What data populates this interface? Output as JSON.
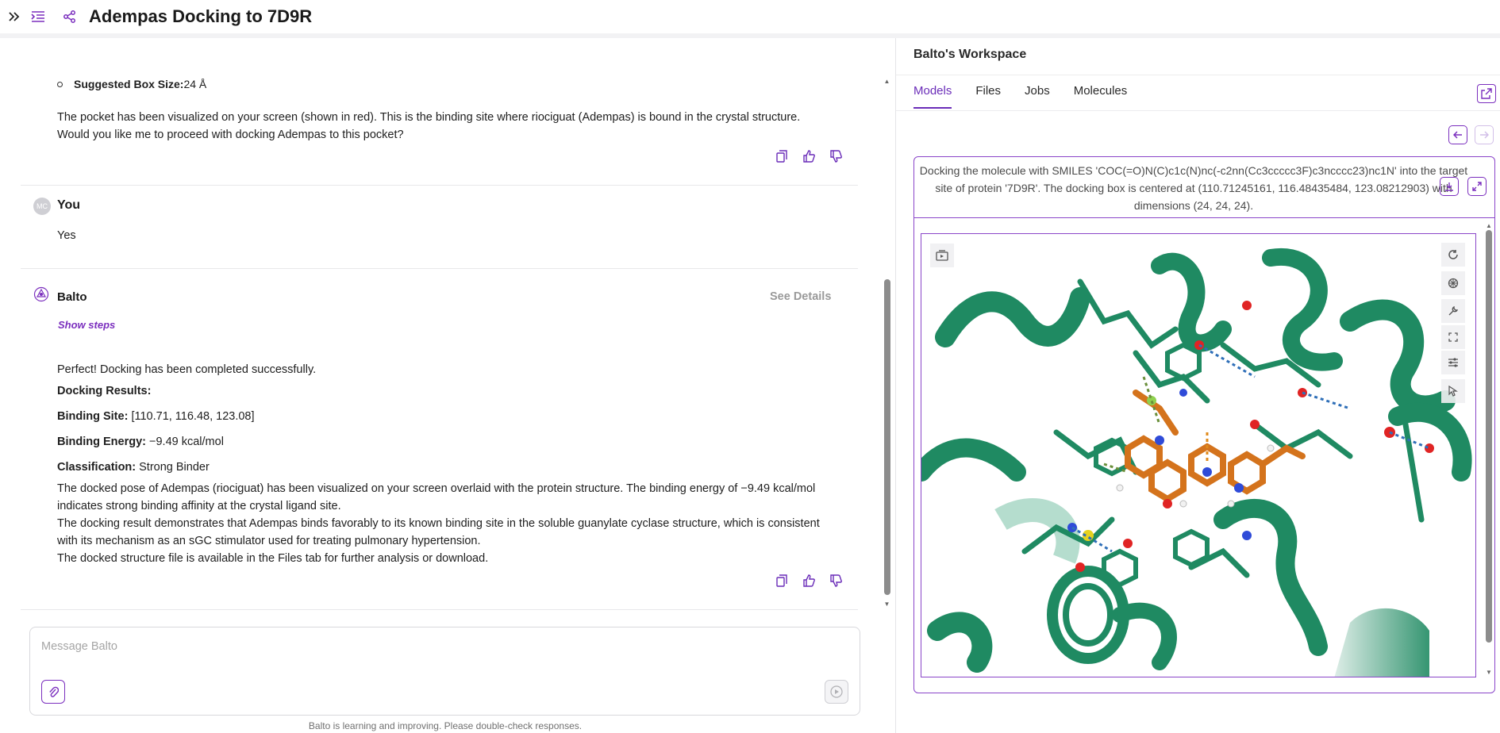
{
  "header": {
    "title": "Adempas Docking to 7D9R"
  },
  "chat": {
    "bullet": {
      "label": "Suggested Box Size:",
      "value": " 24 Å"
    },
    "assistant_msg1": [
      "The pocket has been visualized on your screen (shown in red). This is the binding site where riociguat (Adempas) is bound in the crystal structure.",
      "Would you like me to proceed with docking Adempas to this pocket?"
    ],
    "user": {
      "initials": "MC",
      "name": "You",
      "text": "Yes"
    },
    "assistant": {
      "name": "Balto",
      "see_details": "See Details",
      "show_steps": "Show steps",
      "intro": "Perfect! Docking has been completed successfully.",
      "results_heading": "Docking Results:",
      "binding_site_label": "Binding Site:",
      "binding_site_value": " [110.71, 116.48, 123.08]",
      "binding_energy_label": "Binding Energy:",
      "binding_energy_value": " −9.49 kcal/mol",
      "classification_label": "Classification:",
      "classification_value": " Strong Binder",
      "summary": [
        "The docked pose of Adempas (riociguat) has been visualized on your screen overlaid with the protein structure. The binding energy of −9.49 kcal/mol",
        "indicates strong binding affinity at the crystal ligand site.",
        "The docking result demonstrates that Adempas binds favorably to its known binding site in the soluble guanylate cyclase structure, which is consistent",
        "with its mechanism as an sGC stimulator used for treating pulmonary hypertension.",
        "The docked structure file is available in the Files tab for further analysis or download."
      ]
    },
    "composer": {
      "placeholder": "Message Balto"
    },
    "footnote": "Balto is learning and improving. Please double-check responses."
  },
  "workspace": {
    "title": "Balto's Workspace",
    "tabs": [
      {
        "label": "Models",
        "active": true
      },
      {
        "label": "Files",
        "active": false
      },
      {
        "label": "Jobs",
        "active": false
      },
      {
        "label": "Molecules",
        "active": false
      }
    ],
    "card": {
      "description": "Docking the molecule with SMILES 'COC(=O)N(C)c1c(N)nc(-c2nn(Cc3ccccc3F)c3ncccc23)nc1N' into the target site of protein '7D9R'. The docking box is centered at (110.71245161, 116.48435484, 123.08212903) with dimensions (24, 24, 24)."
    },
    "viewer_tools": [
      "refresh-icon",
      "atom-icon",
      "wrench-icon",
      "fullscreen-icon",
      "sliders-icon",
      "cursor-icon"
    ]
  },
  "colors": {
    "accent": "#7b2fbe",
    "protein": "#1f8a62",
    "ligand": "#d4731c"
  }
}
